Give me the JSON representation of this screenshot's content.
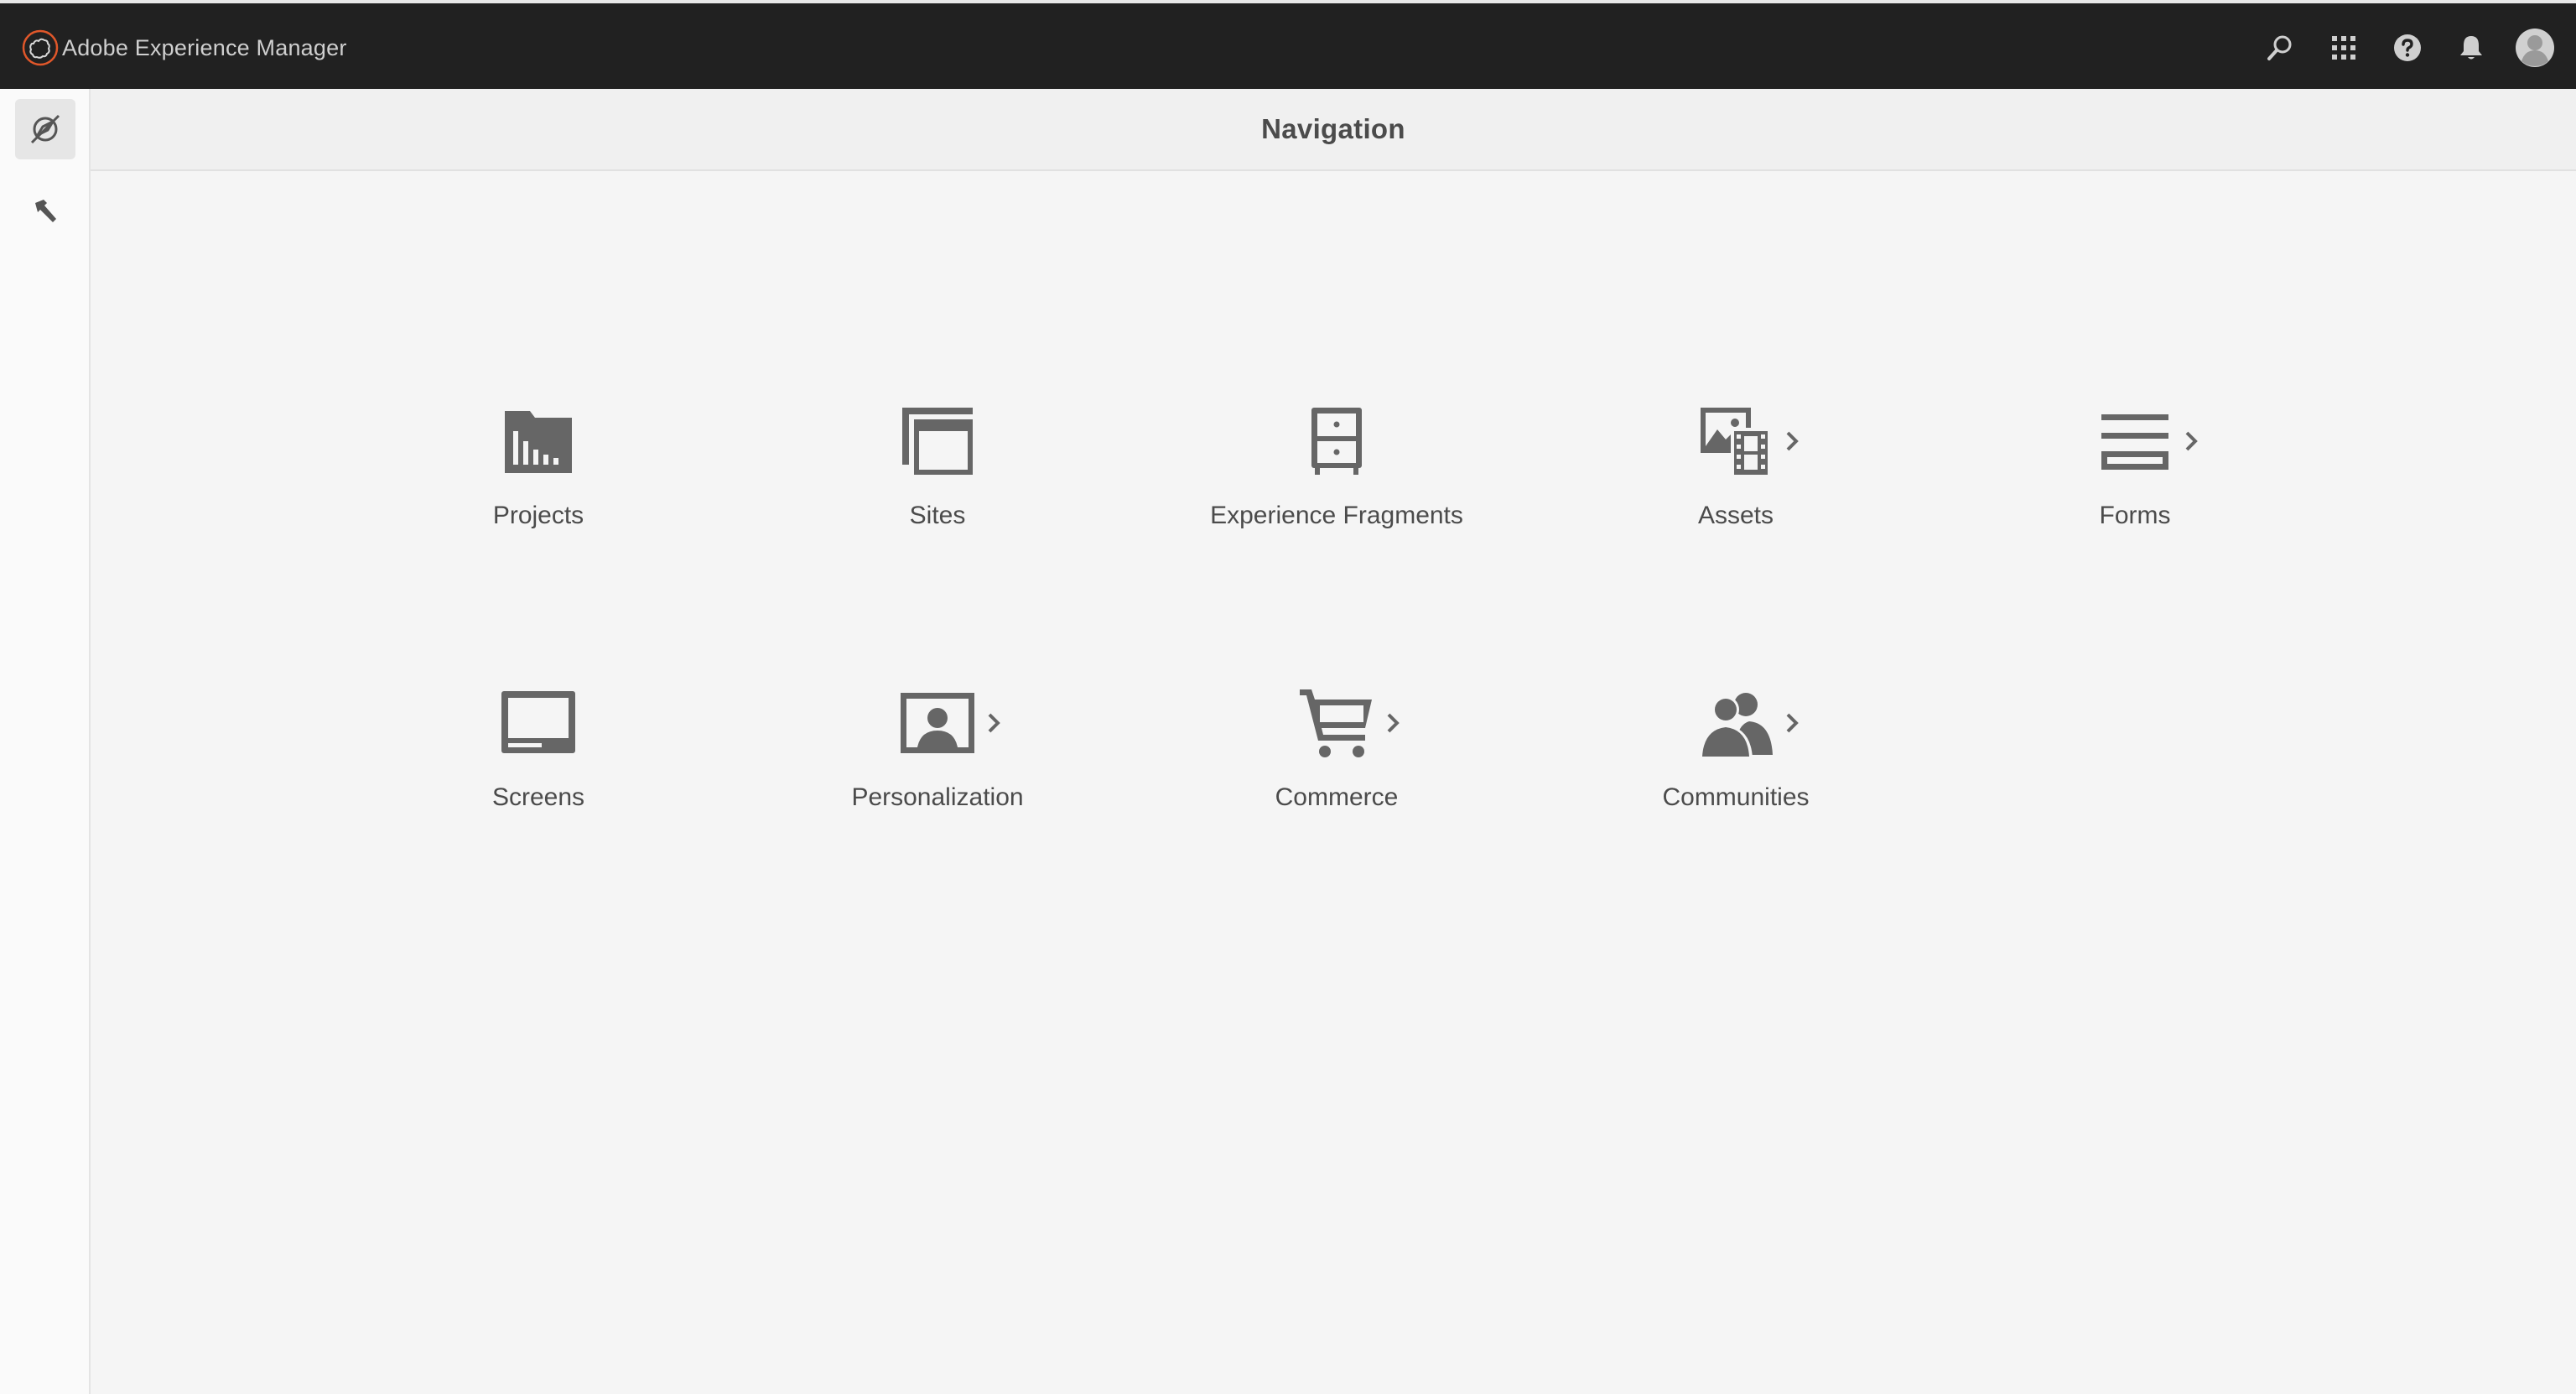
{
  "app": {
    "brand_name": "Adobe Experience Manager",
    "brand_accent": "#e0572a"
  },
  "topbar": {
    "actions": [
      {
        "icon": "search-icon"
      },
      {
        "icon": "apps-grid-icon"
      },
      {
        "icon": "help-icon"
      },
      {
        "icon": "bell-icon"
      },
      {
        "icon": "avatar"
      }
    ]
  },
  "rail": {
    "items": [
      {
        "icon": "navigation-compass-icon",
        "active": true
      },
      {
        "icon": "tools-hammer-icon",
        "active": false
      }
    ]
  },
  "header": {
    "title": "Navigation"
  },
  "nav": {
    "items": [
      {
        "label": "Projects",
        "icon": "projects-icon",
        "has_submenu": false
      },
      {
        "label": "Sites",
        "icon": "sites-icon",
        "has_submenu": false
      },
      {
        "label": "Experience Fragments",
        "icon": "experience-fragments-icon",
        "has_submenu": false
      },
      {
        "label": "Assets",
        "icon": "assets-icon",
        "has_submenu": true
      },
      {
        "label": "Forms",
        "icon": "forms-icon",
        "has_submenu": true
      },
      {
        "label": "Screens",
        "icon": "screens-icon",
        "has_submenu": false
      },
      {
        "label": "Personalization",
        "icon": "personalization-icon",
        "has_submenu": true
      },
      {
        "label": "Commerce",
        "icon": "commerce-cart-icon",
        "has_submenu": true
      },
      {
        "label": "Communities",
        "icon": "communities-icon",
        "has_submenu": true
      }
    ]
  },
  "colors": {
    "topbar_bg": "#212121",
    "icon_gray": "#666666",
    "page_bg": "#f5f5f5"
  }
}
